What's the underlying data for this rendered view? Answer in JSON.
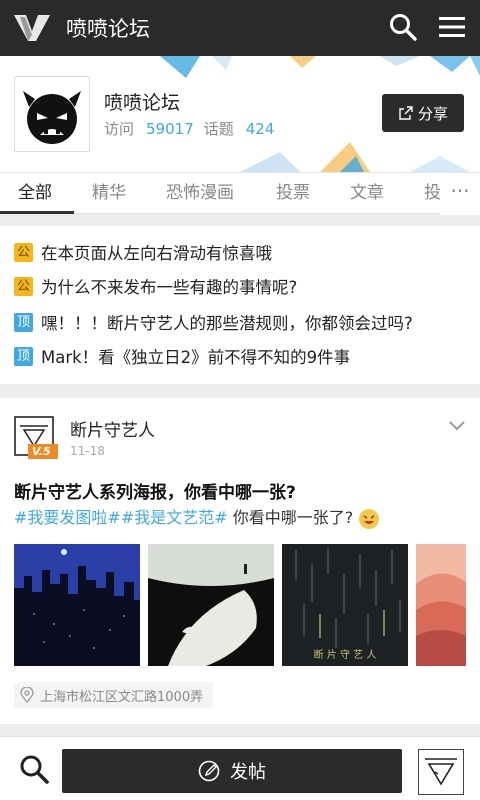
{
  "topbar": {
    "title": "喷喷论坛",
    "logo_icon": "v-logo",
    "search_icon": "search-icon",
    "menu_icon": "hamburger-menu-icon",
    "bg_color": "#2a2a2a"
  },
  "forum": {
    "name": "喷喷论坛",
    "visits_label": "访问",
    "visits": "59017",
    "topics_label": "话题",
    "topics": "424",
    "share_label": "分享",
    "accent": "#3fa9e0"
  },
  "tabs": [
    "全部",
    "精华",
    "恐怖漫画",
    "投票",
    "文章",
    "投"
  ],
  "tabs_more": "···",
  "notices": [
    {
      "tag": "公",
      "type": "gong",
      "text": "在本页面从左向右滑动有惊喜哦"
    },
    {
      "tag": "公",
      "type": "gong",
      "text": "为什么不来发布一些有趣的事情呢?"
    },
    {
      "tag": "顶",
      "type": "ding",
      "text": "嘿！！！断片守艺人的那些潜规则，你都领会过吗?"
    },
    {
      "tag": "顶",
      "type": "ding",
      "text": "Mark！看《独立日2》前不得不知的9件事"
    }
  ],
  "post": {
    "author": "断片守艺人",
    "badge": "V.5",
    "date": "11-18",
    "title": "断片守艺人系列海报，你看中哪一张?",
    "hashtag1": "#我要发图啦#",
    "hashtag2": "#我是文艺范#",
    "body": "你看中哪一张了?",
    "poster_caption": "断 片 守 艺 人",
    "location": "上海市松江区文汇路1000弄"
  },
  "bottombar": {
    "post_label": "发帖",
    "search_icon": "search-icon"
  }
}
